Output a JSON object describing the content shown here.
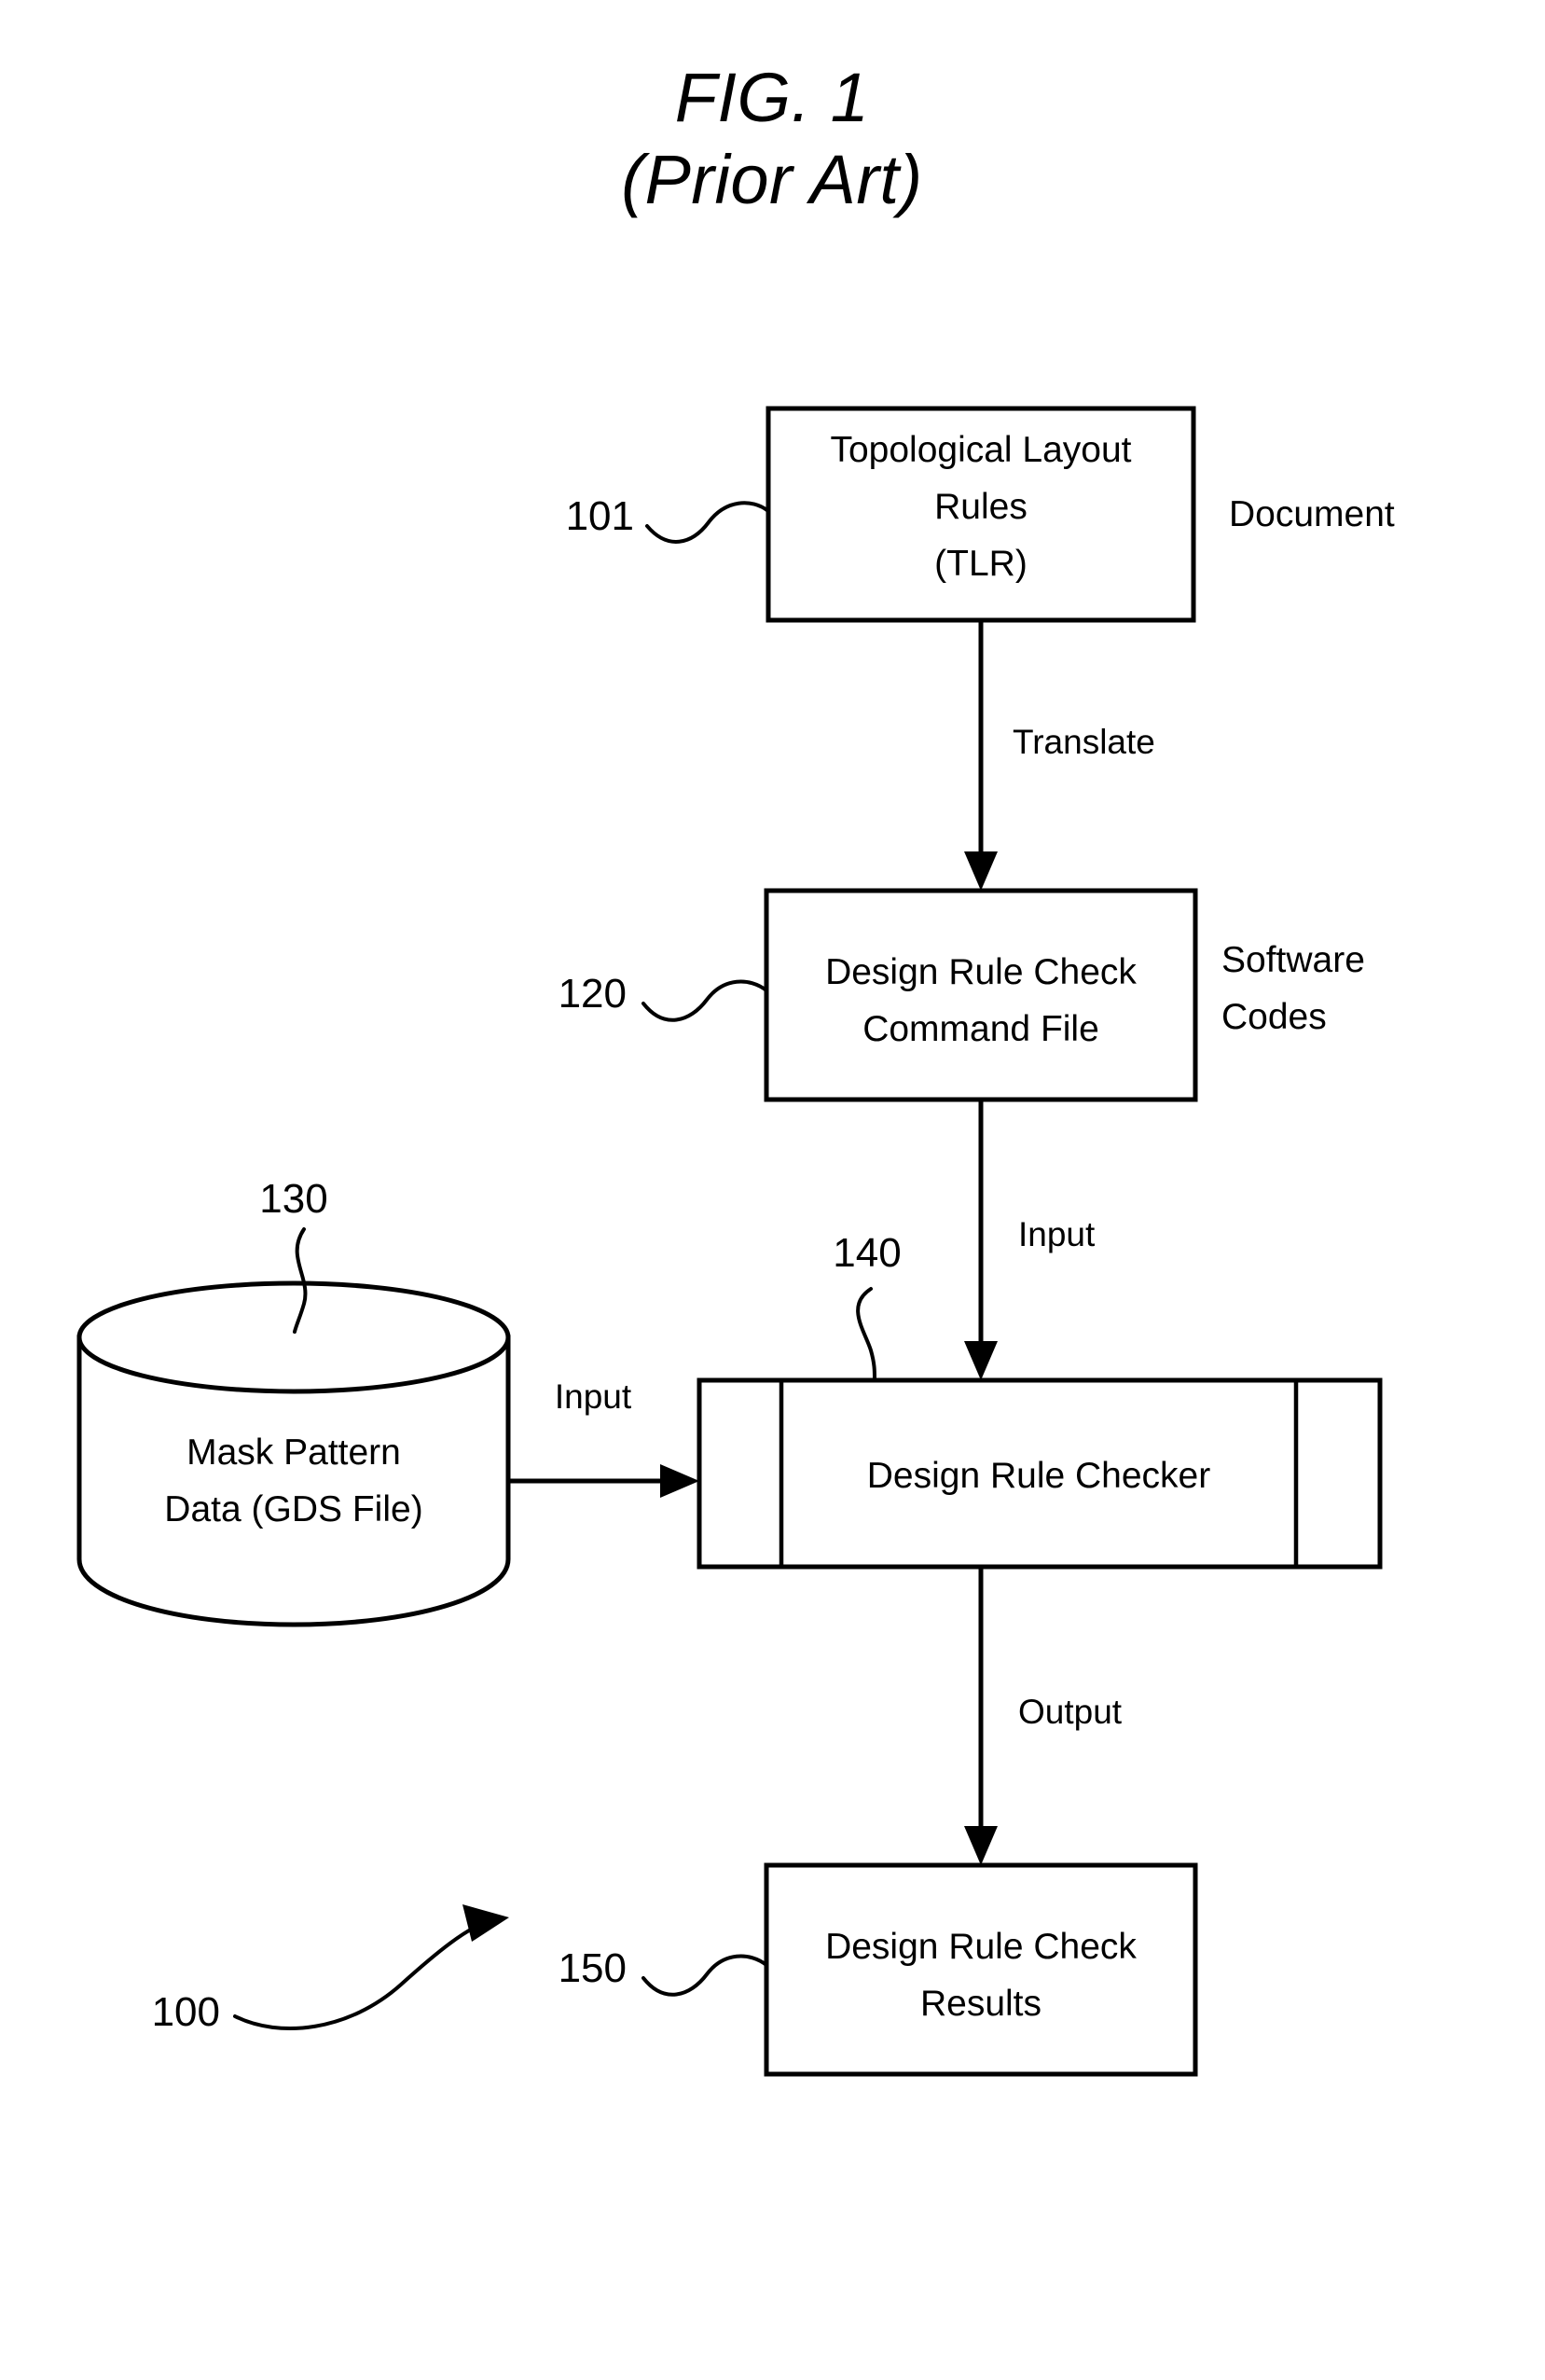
{
  "figure": {
    "title_line1": "FIG. 1",
    "title_line2": "(Prior Art)",
    "system_ref": "100"
  },
  "nodes": {
    "tlr": {
      "ref": "101",
      "line1": "Topological Layout",
      "line2": "Rules",
      "line3": "(TLR)",
      "category_label": "Document"
    },
    "command_file": {
      "ref": "120",
      "line1": "Design Rule Check",
      "line2": "Command File",
      "category_label_line1": "Software",
      "category_label_line2": "Codes"
    },
    "mask_data": {
      "ref": "130",
      "line1": "Mask Pattern",
      "line2": "Data (GDS File)"
    },
    "checker": {
      "ref": "140",
      "line1": "Design Rule Checker"
    },
    "results": {
      "ref": "150",
      "line1": "Design Rule Check",
      "line2": "Results"
    }
  },
  "edges": {
    "translate": "Translate",
    "input_from_command_file": "Input",
    "input_from_mask_data": "Input",
    "output_to_results": "Output"
  },
  "colors": {
    "ink": "#000000",
    "paper": "#ffffff"
  }
}
